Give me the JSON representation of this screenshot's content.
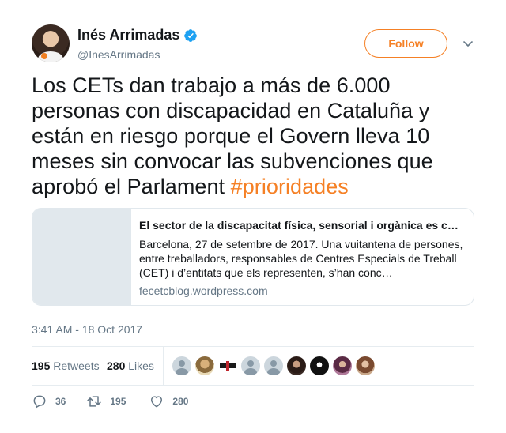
{
  "author": {
    "display_name": "Inés Arrimadas",
    "handle": "@InesArrimadas",
    "verified": true
  },
  "follow_label": "Follow",
  "tweet": {
    "text": "Los CETs dan trabajo a más de 6.000 personas con discapacidad en Cataluña y están en riesgo porque el Govern lleva 10 meses sin convocar las subvenciones que aprobó el Parlament ",
    "hashtag": "#prioridades"
  },
  "card": {
    "title": "El sector de la discapacitat física, sensorial i orgànica es c…",
    "description": "  Barcelona, 27 de setembre de 2017. Una vuitantena de persones, entre treballadors, responsables de Centres Especials de Treball (CET) i d’entitats que els representen, s’han conc…",
    "domain": "fecetcblog.wordpress.com"
  },
  "timestamp": "3:41 AM - 18 Oct 2017",
  "stats": {
    "retweets_count": "195",
    "retweets_label": "Retweets",
    "likes_count": "280",
    "likes_label": "Likes"
  },
  "actions": {
    "replies": "36",
    "retweets": "195",
    "likes": "280"
  },
  "colors": {
    "accent": "#f58025",
    "verified": "#1da1f2",
    "secondary_text": "#657786"
  },
  "icons": [
    "verified-badge-icon",
    "chevron-down-icon",
    "reply-icon",
    "retweet-icon",
    "heart-icon"
  ]
}
